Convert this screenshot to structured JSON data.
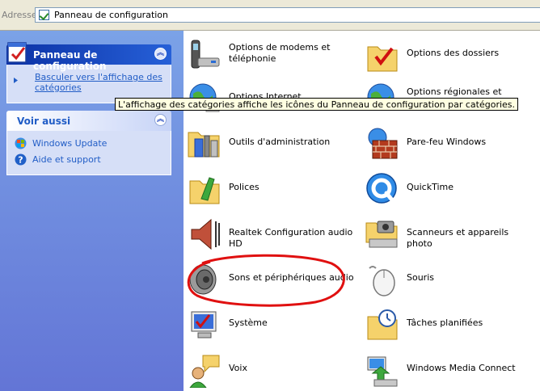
{
  "addressbar": {
    "label": "Adresse",
    "value": "Panneau de configuration"
  },
  "taskpane": {
    "panel_group": {
      "title": "Panneau de configuration",
      "link": "Basculer vers l'affichage des catégories"
    },
    "see_also": {
      "title": "Voir aussi",
      "items": [
        {
          "label": "Windows Update",
          "icon": "windows-update-icon"
        },
        {
          "label": "Aide et support",
          "icon": "help-icon"
        }
      ]
    }
  },
  "tooltip": "L'affichage des catégories affiche les icônes du Panneau de configuration par catégories.",
  "items": [
    {
      "label": "Options de modems et téléphonie",
      "icon": "phone-modem-icon"
    },
    {
      "label": "Options des dossiers",
      "icon": "folder-options-icon"
    },
    {
      "label": "Options Internet",
      "icon": "internet-options-icon"
    },
    {
      "label": "Options régionales et",
      "icon": "regional-options-icon"
    },
    {
      "label": "Outils d'administration",
      "icon": "admin-tools-icon"
    },
    {
      "label": "Pare-feu Windows",
      "icon": "firewall-icon"
    },
    {
      "label": "Polices",
      "icon": "fonts-folder-icon"
    },
    {
      "label": "QuickTime",
      "icon": "quicktime-icon"
    },
    {
      "label": "Realtek Configuration audio HD",
      "icon": "realtek-speaker-icon"
    },
    {
      "label": "Scanneurs et appareils photo",
      "icon": "scanner-camera-icon"
    },
    {
      "label": "Sons et périphériques audio",
      "icon": "sounds-speaker-icon"
    },
    {
      "label": "Souris",
      "icon": "mouse-icon"
    },
    {
      "label": "Système",
      "icon": "system-icon"
    },
    {
      "label": "Tâches planifiées",
      "icon": "scheduled-tasks-icon"
    },
    {
      "label": "Voix",
      "icon": "speech-icon"
    },
    {
      "label": "Windows Media Connect",
      "icon": "media-connect-icon"
    }
  ],
  "colors": {
    "task_pane": "#6f8de0",
    "link": "#215dc6",
    "annotation": "#e01010",
    "tooltip_bg": "#ffffe1"
  }
}
